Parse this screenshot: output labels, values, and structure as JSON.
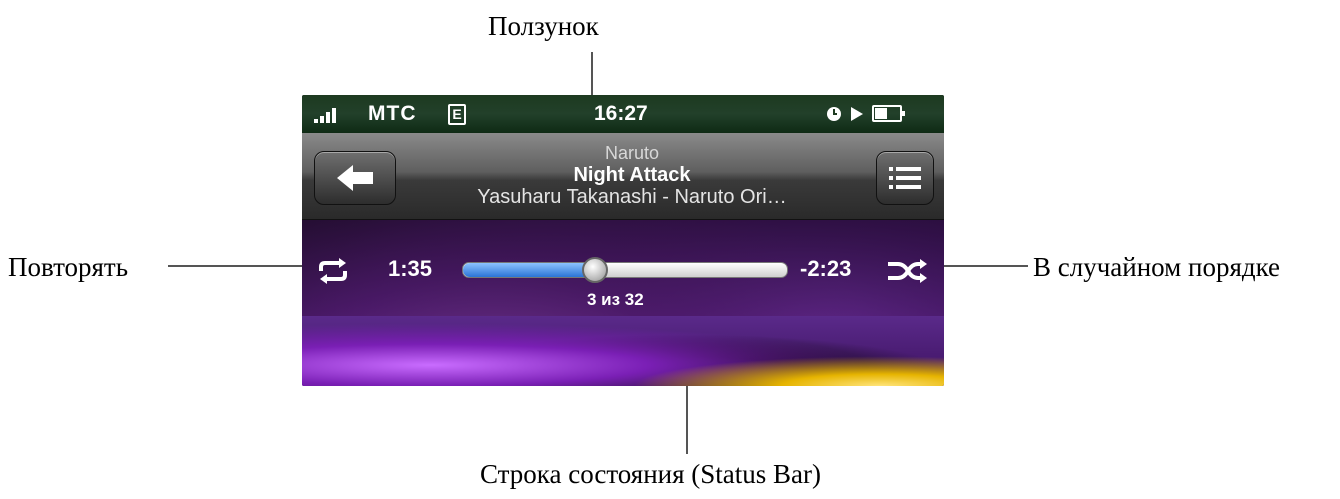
{
  "callouts": {
    "top": "Ползунок",
    "left": "Повторять",
    "right": "В случайном порядке",
    "bottom": "Строка состояния (Status Bar)"
  },
  "statusbar": {
    "carrier": "МТС",
    "network": "E",
    "time": "16:27",
    "icons": [
      "signal-icon",
      "alarm-icon",
      "play-icon",
      "battery-icon"
    ]
  },
  "navbar": {
    "album": "Naruto",
    "title": "Night Attack",
    "artist": "Yasuharu Takanashi - Naruto Ori…",
    "back_icon": "back-arrow-icon",
    "list_icon": "list-icon"
  },
  "controls": {
    "elapsed": "1:35",
    "remaining": "-2:23",
    "track_position": "3 из 32",
    "progress_fraction": 0.4,
    "repeat_icon": "repeat-icon",
    "shuffle_icon": "shuffle-icon"
  },
  "colors": {
    "progress_fill": "#2a74d6",
    "status_bg": "#1d3a20",
    "nav_bg": "#5f5f5f"
  }
}
